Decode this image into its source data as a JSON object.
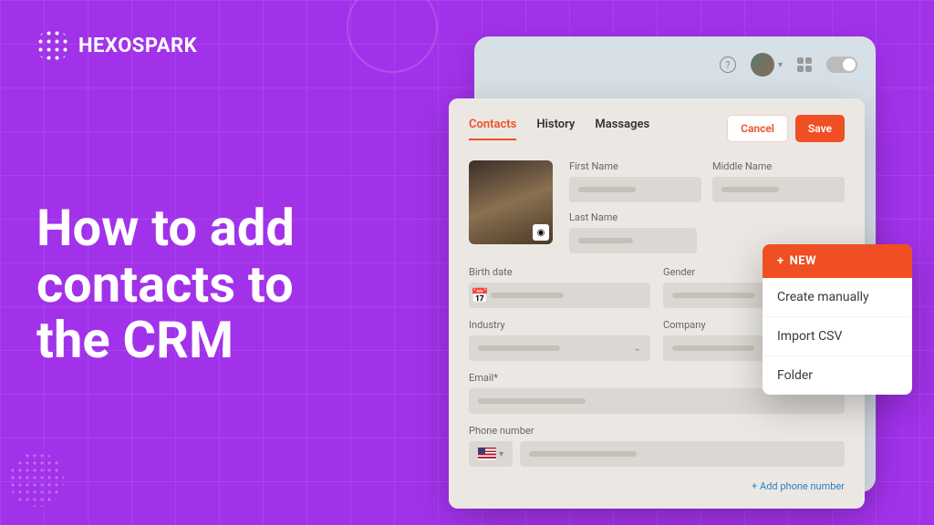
{
  "brand": "HEXOSPARK",
  "headline": "How to add\ncontacts to\nthe CRM",
  "tabs": {
    "contacts": "Contacts",
    "history": "History",
    "messages": "Massages"
  },
  "buttons": {
    "cancel": "Cancel",
    "save": "Save"
  },
  "fields": {
    "firstName": "First Name",
    "middleName": "Middle Name",
    "lastName": "Last Name",
    "birthDate": "Birth date",
    "gender": "Gender",
    "industry": "Industry",
    "company": "Company",
    "email": "Email*",
    "phone": "Phone number"
  },
  "addPhone": "+ Add phone number",
  "popup": {
    "title": "NEW",
    "items": {
      "manual": "Create manually",
      "csv": "Import CSV",
      "folder": "Folder"
    }
  }
}
